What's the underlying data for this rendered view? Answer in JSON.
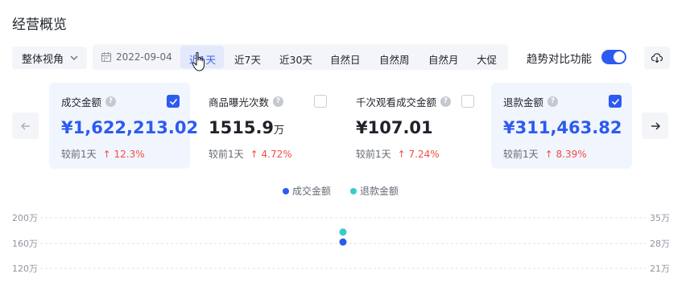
{
  "title": "经营概览",
  "toolbar": {
    "view_select": "整体视角",
    "date": "2022-09-04",
    "tabs": [
      {
        "label": "近1天",
        "active": true
      },
      {
        "label": "近7天"
      },
      {
        "label": "近30天"
      },
      {
        "label": "自然日"
      },
      {
        "label": "自然周"
      },
      {
        "label": "自然月"
      },
      {
        "label": "大促"
      }
    ],
    "compare_label": "趋势对比功能",
    "compare_enabled": true
  },
  "cards": [
    {
      "title": "成交金额",
      "value": "¥1,622,213.02",
      "unit": "",
      "compare_label": "较前1天",
      "delta": "↑ 12.3%",
      "checked": true
    },
    {
      "title": "商品曝光次数",
      "value": "1515.9",
      "unit": "万",
      "compare_label": "较前1天",
      "delta": "↑ 4.72%",
      "checked": false
    },
    {
      "title": "千次观看成交金额",
      "value": "¥107.01",
      "unit": "",
      "compare_label": "较前1天",
      "delta": "↑ 7.24%",
      "checked": false
    },
    {
      "title": "退款金额",
      "value": "¥311,463.82",
      "unit": "",
      "compare_label": "较前1天",
      "delta": "↑ 8.39%",
      "checked": true
    }
  ],
  "colors": {
    "accent": "#2d5af0",
    "series_primary": "#2d5af0",
    "series_secondary": "#3cc9c9",
    "delta_up": "#f54a45"
  },
  "icons": {
    "view_chevron": "chevron-down-icon",
    "calendar": "calendar-icon",
    "download": "cloud-download-icon",
    "prev": "arrow-left-icon",
    "next": "arrow-right-icon",
    "help": "question-circle-icon"
  },
  "chart_data": {
    "type": "scatter",
    "series": [
      {
        "name": "成交金额",
        "values": [
          162.2
        ],
        "axis": "left"
      },
      {
        "name": "退款金额",
        "values": [
          31.1
        ],
        "axis": "right"
      }
    ],
    "left_axis_ticks": [
      "200万",
      "160万",
      "120万"
    ],
    "right_axis_ticks": [
      "35万",
      "28万",
      "21万"
    ],
    "left_axis_values": [
      200,
      160,
      120
    ],
    "right_axis_values": [
      35,
      28,
      21
    ]
  }
}
